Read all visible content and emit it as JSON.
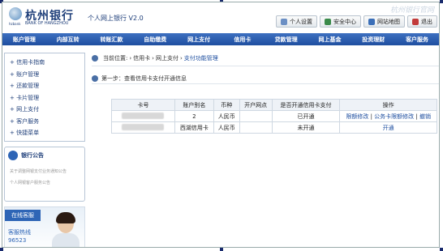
{
  "header": {
    "logo_cn": "杭州银行",
    "logo_en": "BANK OF HANGZHOU",
    "logo_sub": "hzbank",
    "site_title": "个人网上银行 V2.0",
    "watermark": "杭州银行官网",
    "buttons": [
      "个人设置",
      "安全中心",
      "网站地图",
      "退出"
    ]
  },
  "nav": [
    "账户管理",
    "内部互转",
    "转账汇款",
    "自助缴费",
    "网上支付",
    "信用卡",
    "贷款管理",
    "网上基金",
    "投资理财",
    "客户服务"
  ],
  "sidebar": {
    "items": [
      "+ 信用卡指南",
      "+ 账户管理",
      "+ 还款管理",
      "+ 卡片管理",
      "+ 网上支付",
      "+ 客户服务",
      "+ 快捷菜单"
    ],
    "notice_title": "银行公告",
    "notice_lines": [
      "关于调整网银支付业务通知公告",
      "个人网银客户服务公告"
    ],
    "service_tag": "在线客服",
    "hotline_label": "客服热线",
    "hotline_number": "96523"
  },
  "breadcrumb": {
    "label": "当前位置:",
    "items": [
      "信用卡",
      "网上支付",
      "支付功能管理"
    ]
  },
  "step": "第一步：查看信用卡支付开通信息",
  "table": {
    "headers": [
      "卡号",
      "账户别名",
      "币种",
      "开户网点",
      "是否开通信用卡支付",
      "操作"
    ],
    "rows": [
      {
        "alias": "2",
        "currency": "人民币",
        "branch": "",
        "status": "已开通",
        "actions": [
          "限额修改",
          "公务卡限额修改",
          "撤销"
        ]
      },
      {
        "alias": "西湖信用卡",
        "currency": "人民币",
        "branch": "",
        "status": "未开通",
        "actions": [
          "开通"
        ]
      }
    ]
  }
}
